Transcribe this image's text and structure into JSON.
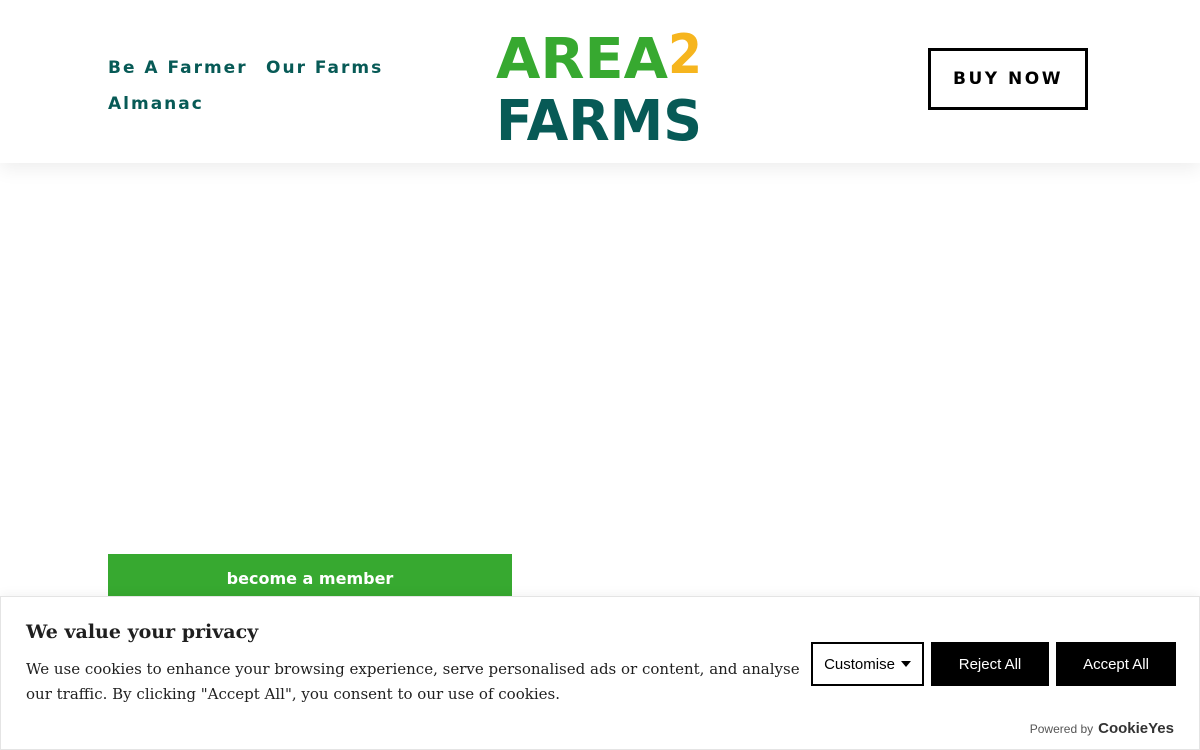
{
  "header": {
    "nav": [
      "Be A Farmer",
      "Our Farms",
      "Almanac"
    ],
    "logo": {
      "line1": "AREA",
      "digit": "2",
      "line2": "FARMS"
    },
    "buy_label": "BUY NOW"
  },
  "hero": {
    "member_label": "become a member"
  },
  "cookie": {
    "title": "We value your privacy",
    "text": "We use cookies to enhance your browsing experience, serve personalised ads or content, and analyse our traffic. By clicking \"Accept All\", you consent to our use of cookies.",
    "customise": "Customise",
    "reject": "Reject All",
    "accept": "Accept All",
    "powered_by": "Powered by",
    "brand": "CookieYes"
  },
  "colors": {
    "green": "#37a930",
    "teal": "#075a56",
    "yellow": "#f6b51e"
  }
}
